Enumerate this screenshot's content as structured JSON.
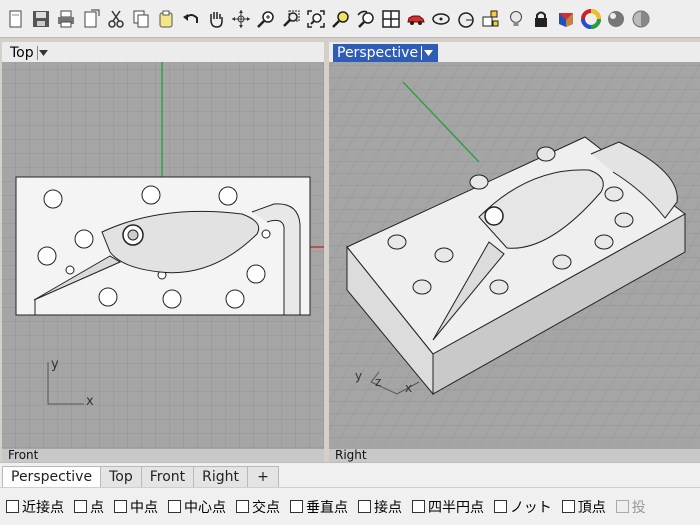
{
  "toolbar": {
    "icons": [
      "new-file",
      "save",
      "print",
      "import",
      "cut",
      "copy",
      "paste",
      "undo",
      "pan",
      "rotate-view",
      "zoom-in",
      "zoom-window",
      "zoom-extents",
      "zoom-selected",
      "undo-view",
      "four-viewports",
      "car-render",
      "ellipse-tool",
      "circle-tool",
      "layer-tool",
      "lightbulb",
      "lock",
      "render-material",
      "color-wheel",
      "sphere-render",
      "sphere-shade"
    ]
  },
  "viewports": {
    "top": {
      "title": "Top",
      "axis_x": "x",
      "axis_y": "y"
    },
    "perspective": {
      "title": "Perspective",
      "axis_x": "x",
      "axis_y": "y",
      "axis_z": "z"
    },
    "bottom_left": {
      "title": "Front"
    },
    "bottom_right": {
      "title": "Right"
    }
  },
  "tabs": [
    {
      "label": "Perspective",
      "active": true
    },
    {
      "label": "Top",
      "active": false
    },
    {
      "label": "Front",
      "active": false
    },
    {
      "label": "Right",
      "active": false
    },
    {
      "label": "+",
      "active": false
    }
  ],
  "osnap": [
    {
      "label": "近接点",
      "enabled": true
    },
    {
      "label": "点",
      "enabled": true
    },
    {
      "label": "中点",
      "enabled": true
    },
    {
      "label": "中心点",
      "enabled": true
    },
    {
      "label": "交点",
      "enabled": true
    },
    {
      "label": "垂直点",
      "enabled": true
    },
    {
      "label": "接点",
      "enabled": true
    },
    {
      "label": "四半円点",
      "enabled": true
    },
    {
      "label": "ノット",
      "enabled": true
    },
    {
      "label": "頂点",
      "enabled": true
    },
    {
      "label": "投",
      "enabled": false
    }
  ],
  "colors": {
    "active_title": "#2f5db5",
    "grid_bg": "#a8a8a8",
    "grid_line": "#9a9a9a",
    "axis_x": "#c0303a",
    "axis_y": "#30a040"
  }
}
